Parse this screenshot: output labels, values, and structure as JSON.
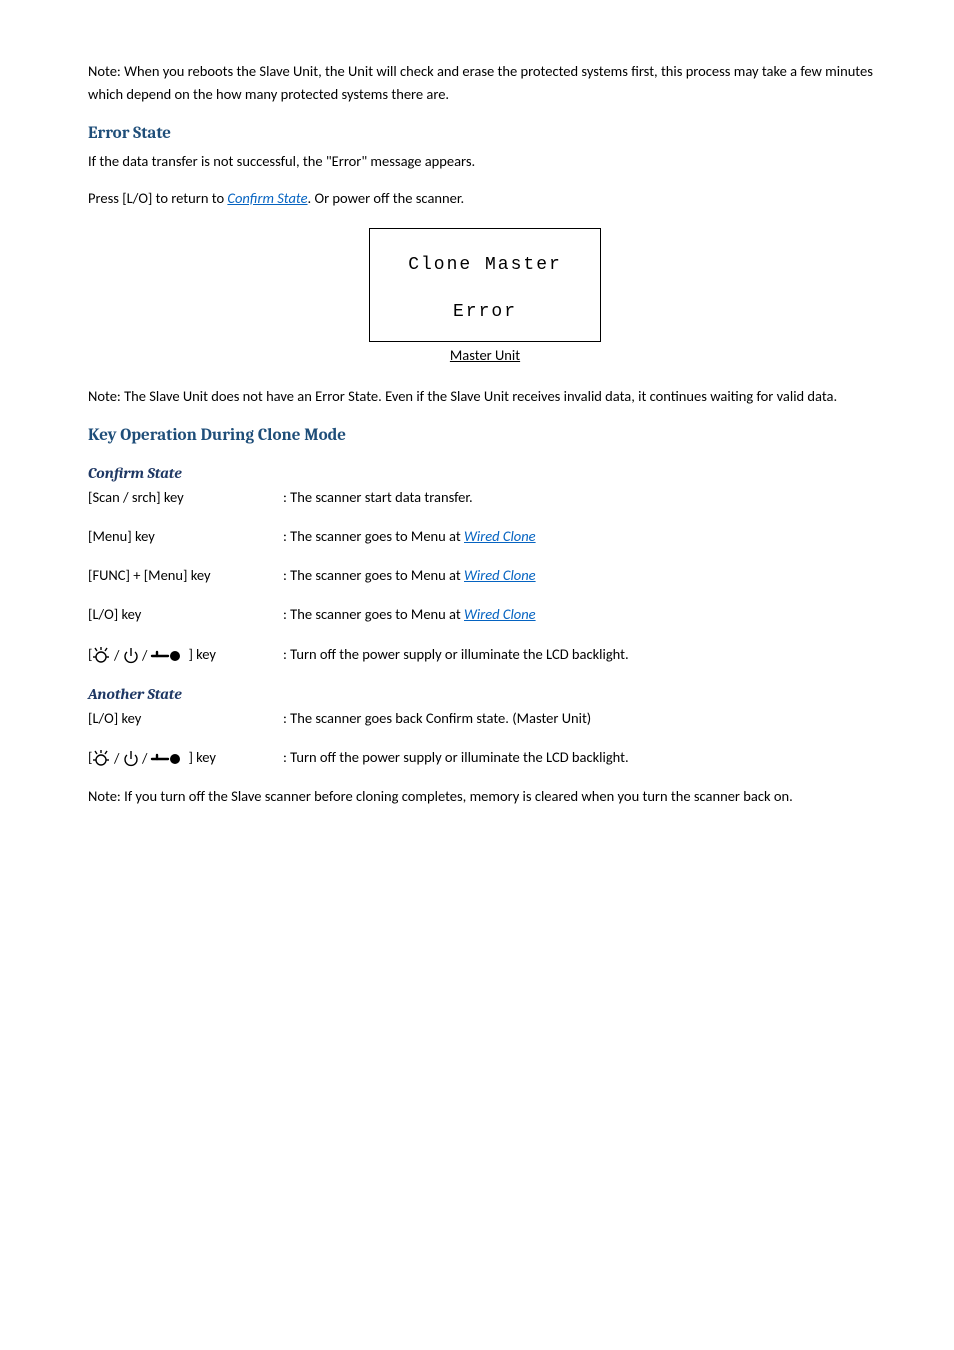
{
  "intro_note": "Note:  When you reboots the Slave Unit, the Unit will check and erase the protected systems first, this process may take a few minutes which depend on the how many protected systems there are.",
  "error_state": {
    "heading": "Error State",
    "line1": "If the data transfer is not successful, the \"Error\" message appears.",
    "line2a": "Press [L/O] to return to ",
    "line2_link": "Confirm State",
    "line2b": ". Or power off the scanner.",
    "lcd_line1": "Clone Master",
    "lcd_line2": "Error",
    "lcd_caption": "Master Unit",
    "note": "Note: The Slave Unit does not have an Error State. Even if the Slave Unit receives invalid data, it continues waiting for valid data."
  },
  "key_op": {
    "heading": "Key Operation During Clone Mode"
  },
  "confirm_state": {
    "heading": "Confirm State",
    "rows": {
      "scan": {
        "key": "[Scan / srch] key",
        "val": ": The scanner start data transfer."
      },
      "menu": {
        "key": "[Menu] key",
        "val_pre": ": The scanner goes to Menu at ",
        "val_link": "Wired Clone"
      },
      "func_menu": {
        "key": "[FUNC] + [Menu] key",
        "val_pre": ": The scanner goes to Menu at ",
        "val_link": "Wired Clone"
      },
      "lo": {
        "key": "[L/O] key",
        "val_pre": ": The scanner goes to Menu at ",
        "val_link": "Wired Clone"
      },
      "power": {
        "key_suffix": "] key",
        "val": ": Turn off the power supply or illuminate the LCD backlight."
      }
    }
  },
  "another_state": {
    "heading": "Another State",
    "rows": {
      "lo": {
        "key": "[L/O] key",
        "val": ": The scanner goes back Confirm state. (Master Unit)"
      },
      "power": {
        "key_suffix": "] key",
        "val": ": Turn off the power supply or illuminate the LCD backlight."
      }
    }
  },
  "final_note": "Note: If you turn off the Slave scanner before cloning completes, memory is cleared when you turn the scanner back on."
}
